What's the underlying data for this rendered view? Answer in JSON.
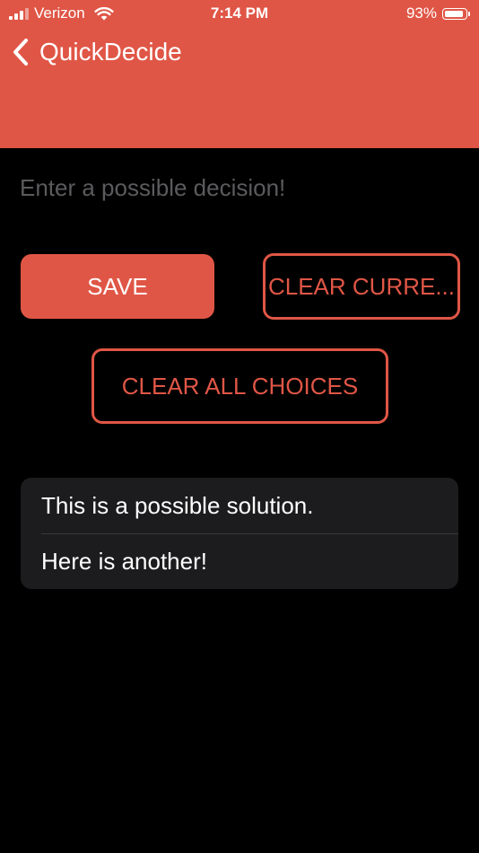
{
  "status_bar": {
    "carrier": "Verizon",
    "time": "7:14 PM",
    "battery_percent": "93%",
    "battery_level": 0.93
  },
  "nav": {
    "back_icon": "chevron-left-icon",
    "title": "QuickDecide"
  },
  "input": {
    "value": "",
    "placeholder": "Enter a possible decision!"
  },
  "buttons": {
    "save": "SAVE",
    "clear_current": "CLEAR CURRE...",
    "clear_all": "CLEAR ALL CHOICES"
  },
  "choices": [
    {
      "label": "This is a possible solution."
    },
    {
      "label": "Here is another!"
    }
  ],
  "colors": {
    "accent": "#E05646",
    "background": "#000000",
    "list_background": "#1C1C1E",
    "placeholder": "#5B5B5E"
  }
}
